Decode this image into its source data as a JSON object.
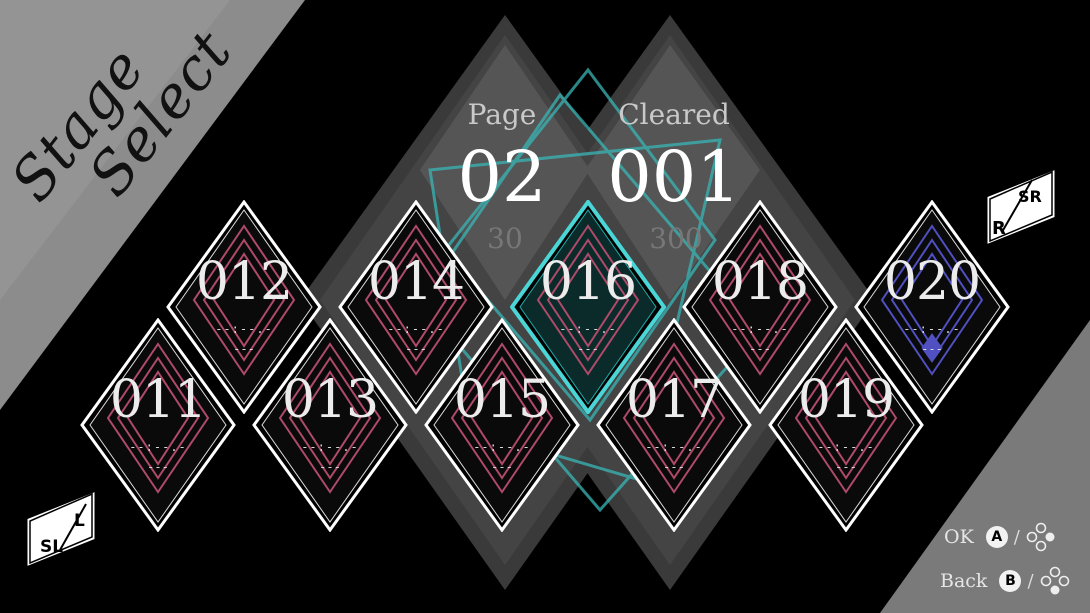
{
  "title": {
    "line1": "Stage",
    "line2": "Select"
  },
  "stats": {
    "page": {
      "label": "Page",
      "value": "02",
      "total": "30"
    },
    "cleared": {
      "label": "Cleared",
      "value": "001",
      "total": "300"
    }
  },
  "stages": [
    {
      "number": "011",
      "dash1": "--:--.-",
      "dash2": "---",
      "state": "normal"
    },
    {
      "number": "012",
      "dash1": "--:--.-",
      "dash2": "---",
      "state": "normal"
    },
    {
      "number": "013",
      "dash1": "--:--.-",
      "dash2": "---",
      "state": "normal"
    },
    {
      "number": "014",
      "dash1": "--:--.-",
      "dash2": "---",
      "state": "normal"
    },
    {
      "number": "015",
      "dash1": "--:--.-",
      "dash2": "---",
      "state": "normal"
    },
    {
      "number": "016",
      "dash1": "--:--.-",
      "dash2": "---",
      "state": "selected"
    },
    {
      "number": "017",
      "dash1": "--:--.-",
      "dash2": "---",
      "state": "normal"
    },
    {
      "number": "018",
      "dash1": "--:--.-",
      "dash2": "---",
      "state": "normal"
    },
    {
      "number": "019",
      "dash1": "--:--.-",
      "dash2": "---",
      "state": "normal"
    },
    {
      "number": "020",
      "dash1": "--:--.-",
      "dash2": "---",
      "state": "special"
    }
  ],
  "page_buttons": {
    "prev": {
      "top": "L",
      "bottom": "SL"
    },
    "next": {
      "top": "SR",
      "bottom": "R"
    }
  },
  "hints": {
    "ok": {
      "label": "OK",
      "button": "A"
    },
    "back": {
      "label": "Back",
      "button": "B"
    }
  },
  "colors": {
    "tile_inner_normal": "#b04a6a",
    "tile_inner_special": "#5050c0",
    "tile_selected_border": "#4ad6d6",
    "background": "#000000",
    "banner": "#8a8a8a"
  }
}
